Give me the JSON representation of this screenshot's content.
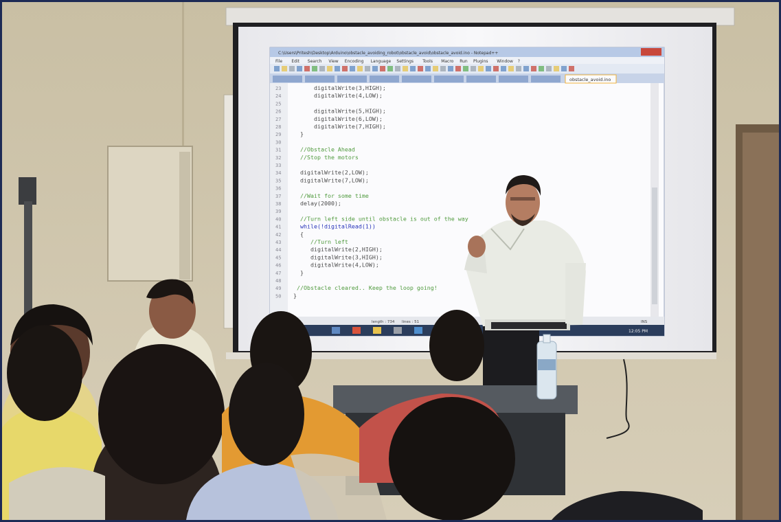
{
  "scene": {
    "caption": "Classroom photo: instructor presenting Arduino code projected in Notepad++ to seated students"
  },
  "editor": {
    "title": "C:\\Users\\Pritesh\\Desktop\\Arduino\\obstacle_avoiding_robot\\obstacle_avoid\\obstacle_avoid.ino - Notepad++",
    "menu": [
      "File",
      "Edit",
      "Search",
      "View",
      "Encoding",
      "Language",
      "Settings",
      "Tools",
      "Macro",
      "Run",
      "Plugins",
      "Window",
      "?"
    ],
    "active_tab": "obstacle_avoid.ino",
    "lines": [
      {
        "n": "23",
        "code": "      digitalWrite(3,HIGH);",
        "kind": "code"
      },
      {
        "n": "24",
        "code": "      digitalWrite(4,LOW);",
        "kind": "code"
      },
      {
        "n": "25",
        "code": "",
        "kind": "code"
      },
      {
        "n": "26",
        "code": "      digitalWrite(5,HIGH);",
        "kind": "code"
      },
      {
        "n": "27",
        "code": "      digitalWrite(6,LOW);",
        "kind": "code"
      },
      {
        "n": "28",
        "code": "      digitalWrite(7,HIGH);",
        "kind": "code"
      },
      {
        "n": "29",
        "code": "  }",
        "kind": "code"
      },
      {
        "n": "30",
        "code": "",
        "kind": "code"
      },
      {
        "n": "31",
        "code": "  //Obstacle Ahead",
        "kind": "comment"
      },
      {
        "n": "32",
        "code": "  //Stop the motors",
        "kind": "comment"
      },
      {
        "n": "33",
        "code": "",
        "kind": "code"
      },
      {
        "n": "34",
        "code": "  digitalWrite(2,LOW);",
        "kind": "code"
      },
      {
        "n": "35",
        "code": "  digitalWrite(7,LOW);",
        "kind": "code"
      },
      {
        "n": "36",
        "code": "",
        "kind": "code"
      },
      {
        "n": "37",
        "code": "  //Wait for some time",
        "kind": "comment"
      },
      {
        "n": "38",
        "code": "  delay(2000);",
        "kind": "code"
      },
      {
        "n": "39",
        "code": "",
        "kind": "code"
      },
      {
        "n": "40",
        "code": "  //Turn left side until obstacle is out of the way",
        "kind": "comment"
      },
      {
        "n": "41",
        "code": "  while(!digitalRead(1))",
        "kind": "keyword"
      },
      {
        "n": "42",
        "code": "  {",
        "kind": "code"
      },
      {
        "n": "43",
        "code": "     //Turn left",
        "kind": "comment"
      },
      {
        "n": "44",
        "code": "     digitalWrite(2,HIGH);",
        "kind": "code"
      },
      {
        "n": "45",
        "code": "     digitalWrite(3,HIGH);",
        "kind": "code"
      },
      {
        "n": "46",
        "code": "     digitalWrite(4,LOW);",
        "kind": "code"
      },
      {
        "n": "47",
        "code": "  }",
        "kind": "code"
      },
      {
        "n": "48",
        "code": "",
        "kind": "code"
      },
      {
        "n": "49",
        "code": " //Obstacle cleared.. Keep the loop going!",
        "kind": "comment"
      },
      {
        "n": "50",
        "code": "}",
        "kind": "code"
      }
    ],
    "status_length": "length : 734",
    "status_lines": "lines : 51",
    "status_ins": "INS",
    "clock": "12:05 PM"
  },
  "colors": {
    "wall": "#cdc2a6",
    "screen": "#f4f4f6",
    "comment": "#4f9a3d",
    "keyword": "#2330b8",
    "code": "#4a4a4a",
    "frame": "#1d2a55"
  }
}
